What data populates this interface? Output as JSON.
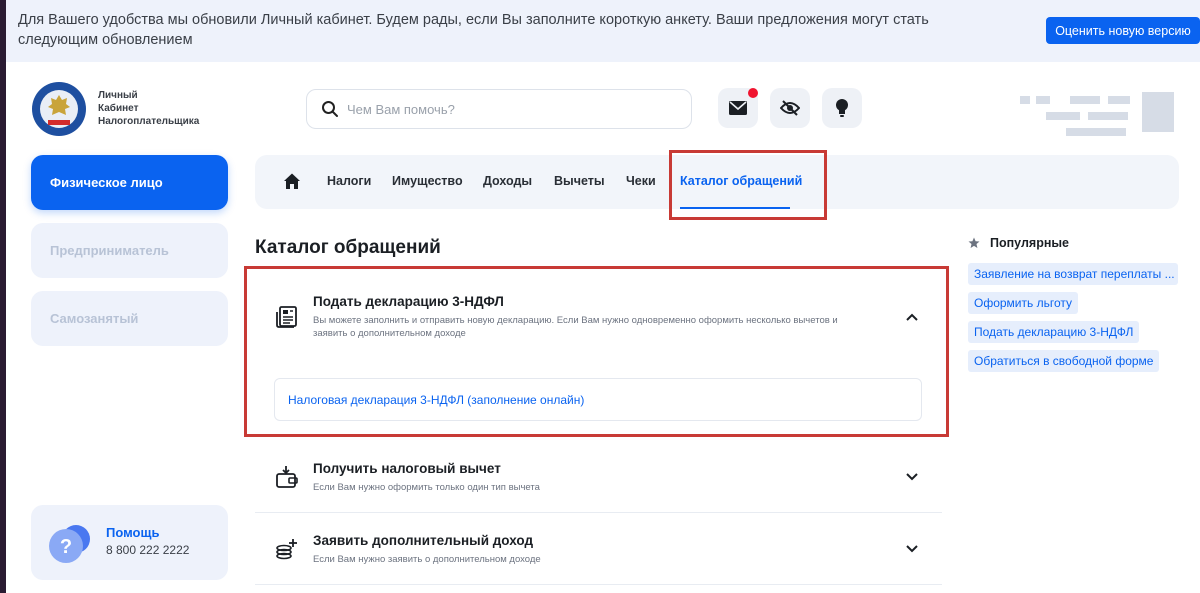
{
  "banner": {
    "text": "Для Вашего удобства мы обновили Личный кабинет. Будем рады, если Вы заполните короткую анкету. Ваши предложения могут стать следующим обновлением",
    "button_label": "Оценить новую версию"
  },
  "header": {
    "logo_text_line1": "Личный",
    "logo_text_line2": "Кабинет",
    "logo_text_line3": "Налогоплательщика",
    "search_placeholder": "Чем Вам помочь?",
    "icons": [
      "mail-icon",
      "eye-off-icon",
      "lightbulb-icon"
    ]
  },
  "sidebar": {
    "items": [
      {
        "label": "Физическое лицо",
        "active": true
      },
      {
        "label": "Предприниматель",
        "active": false
      },
      {
        "label": "Самозанятый",
        "active": false
      }
    ],
    "help_title": "Помощь",
    "help_phone": "8 800 222 2222"
  },
  "nav": {
    "items": [
      "Налоги",
      "Имущество",
      "Доходы",
      "Вычеты",
      "Чеки",
      "Каталог обращений"
    ],
    "active_index": 5
  },
  "page": {
    "title": "Каталог обращений"
  },
  "accordion": [
    {
      "title": "Подать декларацию 3-НДФЛ",
      "description": "Вы можете заполнить и отправить новую декларацию. Если Вам нужно одновременно оформить несколько вычетов и заявить о дополнительном доходе",
      "expanded": true,
      "links": [
        "Налоговая декларация 3-НДФЛ (заполнение онлайн)"
      ]
    },
    {
      "title": "Получить налоговый вычет",
      "description": "Если Вам нужно оформить только один тип вычета",
      "expanded": false
    },
    {
      "title": "Заявить дополнительный доход",
      "description": "Если Вам нужно заявить о дополнительном доходе",
      "expanded": false
    }
  ],
  "popular": {
    "title": "Популярные",
    "items": [
      "Заявление на возврат переплаты ...",
      "Оформить льготу",
      "Подать декларацию 3-НДФЛ",
      "Обратиться в свободной форме"
    ]
  },
  "colors": {
    "accent": "#0a63f0",
    "highlight": "#c83a35",
    "notification": "#f0142f"
  }
}
